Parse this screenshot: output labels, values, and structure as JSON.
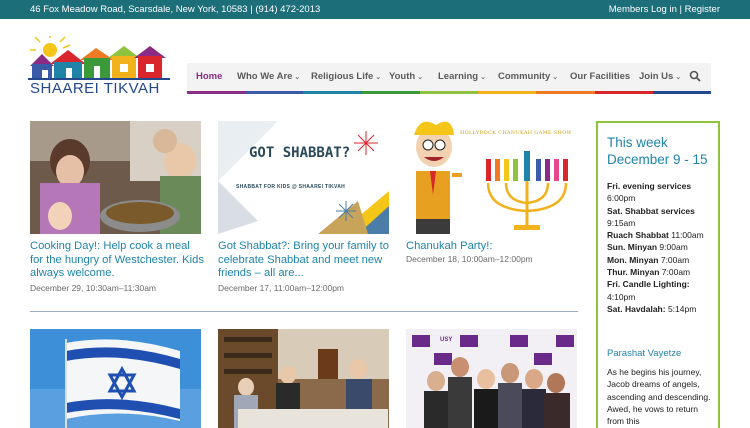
{
  "topbar": {
    "address": "46 Fox Meadow Road, Scarsdale, New York, 10583 | (914) 472-2013",
    "login": "Members Log in",
    "separator": " | ",
    "register": "Register"
  },
  "logo": {
    "text": "SHAAREI TIKVAH"
  },
  "nav": {
    "items": [
      {
        "label": "Home",
        "caret": ""
      },
      {
        "label": "Who We Are",
        "caret": "⌄"
      },
      {
        "label": "Religious Life",
        "caret": "⌄"
      },
      {
        "label": "Youth",
        "caret": "⌄"
      },
      {
        "label": "Learning",
        "caret": "⌄"
      },
      {
        "label": "Community",
        "caret": "⌄"
      },
      {
        "label": "Our Facilities",
        "caret": ""
      },
      {
        "label": "Join Us",
        "caret": "⌄"
      }
    ],
    "rainbow": [
      "#8a2c85",
      "#3b5ba8",
      "#1f84a8",
      "#3a9a3a",
      "#8fc23d",
      "#f2b21c",
      "#ee7a23",
      "#d8262c",
      "#24488e"
    ]
  },
  "events": [
    {
      "title": "Cooking Day!: Help cook a meal for the hungry of Westchester. Kids always welcome.",
      "date": "December 29, 10:30am–11:30am"
    },
    {
      "title": "Got Shabbat?: Bring your family to celebrate Shabbat and meet new friends – all are...",
      "date": "December 17, 11:00am–12:00pm",
      "image_text": {
        "headline": "GOT SHABBAT?",
        "sub": "SHABBAT FOR KIDS @ SHAAREI TIKVAH"
      }
    },
    {
      "title": "Chanukah Party!:",
      "date": "December 18, 10:00am–12:00pm",
      "image_text": {
        "banner": "HOLLYROCK CHANUKAH GAME SHOW"
      }
    }
  ],
  "bottom_images": [
    {
      "text": ""
    },
    {
      "text": ""
    },
    {
      "text": "USY"
    }
  ],
  "sidebar": {
    "heading_line1": "This week",
    "heading_line2": "December 9 - 15",
    "schedule": [
      {
        "label": "Fri. evening services",
        "value": "6:00pm",
        "newline": true
      },
      {
        "label": "Sat. Shabbat services",
        "value": "9:15am",
        "newline": true
      },
      {
        "label": "Ruach Shabbat",
        "value": " 11:00am",
        "newline": false
      },
      {
        "label": "Sun. Minyan",
        "value": " 9:00am",
        "newline": false
      },
      {
        "label": "Mon. Minyan",
        "value": " 7:00am",
        "newline": false
      },
      {
        "label": "Thur. Minyan",
        "value": " 7:00am",
        "newline": false
      },
      {
        "label": "Fri. Candle Lighting:",
        "value": "4:10pm",
        "newline": true
      },
      {
        "label": "Sat. Havdalah:",
        "value": " 5:14pm",
        "newline": false
      }
    ],
    "subheading": "Parashat Vayetze",
    "paragraph": "As he begins his journey, Jacob dreams of angels, ascending and descending. Awed, he vows to return from this"
  }
}
